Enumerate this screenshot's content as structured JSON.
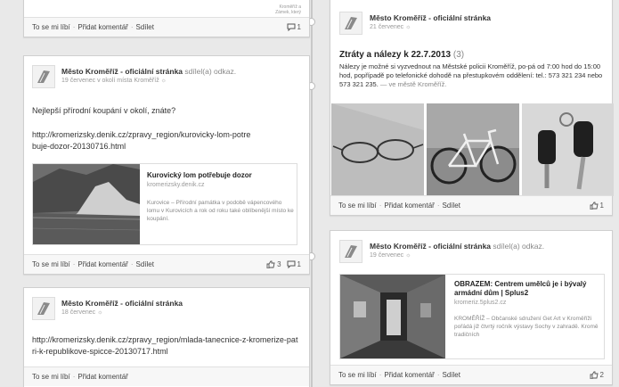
{
  "actions": {
    "like": "To se mi líbí",
    "comment": "Přidat komentář",
    "share": "Sdílet"
  },
  "post_top_left": {
    "snippet_line1": "Kroměříž a",
    "snippet_line2": "Zámek, který",
    "comment_count": "1"
  },
  "post1": {
    "author": "Město Kroměříž - oficiální stránka",
    "author_suffix": "sdílel(a) odkaz.",
    "meta": "19 červenec v okolí místa Kroměříž",
    "text": "Nejlepší přírodní koupání v okolí, znáte?",
    "url": "http://kromerizsky.denik.cz/zpravy_region/kurovicky-lom-potrebuje-dozor-20130716.html",
    "preview_title": "Kurovický lom potřebuje dozor",
    "preview_domain": "kromerizsky.denik.cz",
    "preview_desc": "Kurovice – Přírodní památka v podobě vápencového lomu v Kurovicích a rok od roku také oblíbenější místo ke koupání.",
    "like_count": "3",
    "comment_count": "1"
  },
  "post2": {
    "author": "Město Kroměříž - oficiální stránka",
    "meta": "18 červenec",
    "url": "http://kromerizsky.denik.cz/zpravy_region/mlada-tanecnice-z-kromerize-patri-k-republikove-spicce-20130717.html"
  },
  "post3": {
    "author": "Město Kroměříž - oficiální stránka",
    "meta": "21 červenec",
    "title": "Ztráty a nálezy k 22.7.2013",
    "title_count": "(3)",
    "text": "Nálezy je možné si vyzvednout na Městské policii Kroměříž, po-pá od 7:00 hod do 15:00 hod, popřípadě po telefonické dohodě na přestupkovém oddělení: tel.: 573 321 234 nebo 573 321 235.",
    "text_suffix": "— ve městě Kroměříž.",
    "like_count": "1"
  },
  "post4": {
    "author": "Město Kroměříž - oficiální stránka",
    "author_suffix": "sdílel(a) odkaz.",
    "meta": "19 červenec",
    "preview_title": "OBRAZEM: Centrem umělců je i bývalý armádní dům | Splus2",
    "preview_domain": "kromeriz.5plus2.cz",
    "preview_desc": "KROMĚŘÍŽ – Občanské sdružení Get Art v Kroměříži pořádá již čtvrtý ročník výstavy Sochy v zahradě. Kromě tradičních",
    "like_count": "2"
  }
}
